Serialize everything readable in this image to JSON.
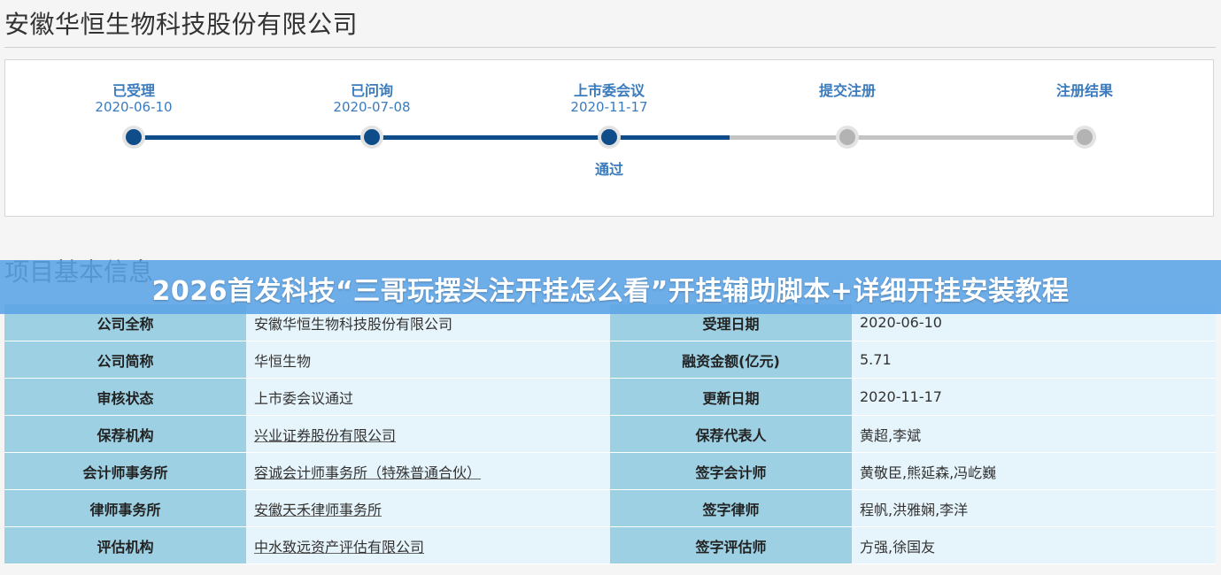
{
  "header": {
    "company_title": "安徽华恒生物科技股份有限公司"
  },
  "progress": {
    "steps": [
      {
        "label": "已受理",
        "date": "2020-06-10",
        "done": true,
        "result": ""
      },
      {
        "label": "已问询",
        "date": "2020-07-08",
        "done": true,
        "result": ""
      },
      {
        "label": "上市委会议",
        "date": "2020-11-17",
        "done": true,
        "result": "通过"
      },
      {
        "label": "提交注册",
        "date": "",
        "done": false,
        "result": ""
      },
      {
        "label": "注册结果",
        "date": "",
        "done": false,
        "result": ""
      }
    ],
    "colors": {
      "done": "#0f4d8a",
      "todo": "#b3b3b3",
      "label": "#3a7bbd"
    }
  },
  "section": {
    "title": "项目基本信息"
  },
  "banner": {
    "text": "2026首发科技“三哥玩摆头注开挂怎么看”开挂辅助脚本+详细开挂安装教程"
  },
  "table": {
    "rows": [
      {
        "l1": "公司全称",
        "v1": "安徽华恒生物科技股份有限公司",
        "l2": "受理日期",
        "v2": "2020-06-10"
      },
      {
        "l1": "公司简称",
        "v1": "华恒生物",
        "l2": "融资金额(亿元)",
        "v2": "5.71"
      },
      {
        "l1": "审核状态",
        "v1": "上市委会议通过",
        "l2": "更新日期",
        "v2": "2020-11-17"
      },
      {
        "l1": "保荐机构",
        "v1": "兴业证券股份有限公司",
        "l2": "保荐代表人",
        "v2": "黄超,李斌"
      },
      {
        "l1": "会计师事务所",
        "v1": "容诚会计师事务所（特殊普通合伙）",
        "l2": "签字会计师",
        "v2": "黄敬臣,熊延森,冯屹巍"
      },
      {
        "l1": "律师事务所",
        "v1": "安徽天禾律师事务所",
        "l2": "签字律师",
        "v2": "程帆,洪雅娴,李洋"
      },
      {
        "l1": "评估机构",
        "v1": "中水致远资产评估有限公司",
        "l2": "签字评估师",
        "v2": "方强,徐国友"
      }
    ]
  },
  "colors": {
    "label_bg": "#9dd0e3",
    "value_bg": "#e6f4fb",
    "banner_bg": "#5aa3e6"
  }
}
